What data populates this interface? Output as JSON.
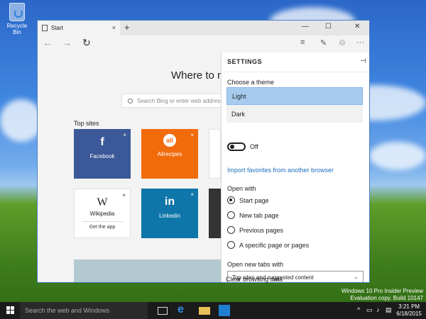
{
  "desktop": {
    "recycle_bin_label": "Recycle Bin"
  },
  "browser": {
    "tab_title": "Start",
    "tab_close": "×",
    "new_tab": "+",
    "minimize": "—",
    "maximize": "☐",
    "close": "✕",
    "back": "←",
    "forward": "→",
    "refresh": "↻",
    "more": "···"
  },
  "start_page": {
    "heading": "Where to ne",
    "search_placeholder": "Search Bing or enter web address",
    "top_sites_label": "Top sites",
    "tiles": [
      {
        "name": "Facebook",
        "logo": "f",
        "color": "#3b5998"
      },
      {
        "name": "Allrecipes",
        "logo": "all",
        "color": "#f16b0b"
      },
      {
        "name": "Wikipedia",
        "logo": "W",
        "sub": "Get the app",
        "color": "#ffffff"
      },
      {
        "name": "Linkedin",
        "logo": "in",
        "color": "#0e76a8"
      }
    ],
    "tile_close": "×"
  },
  "settings": {
    "title": "SETTINGS",
    "pin": "⊣",
    "theme_label": "Choose a theme",
    "theme_options": [
      "Light",
      "Dark"
    ],
    "toggle_state": "Off",
    "import_link": "Import favorites from another browser",
    "open_with_label": "Open with",
    "open_with_options": [
      "Start page",
      "New tab page",
      "Previous pages",
      "A specific page or pages"
    ],
    "open_with_selected": "Start page",
    "new_tabs_label": "Open new tabs with",
    "new_tabs_value": "Top sites and suggested content",
    "clear_label": "Clear browsing data"
  },
  "watermark": {
    "line1": "Windows 10 Pro Insider Preview",
    "line2": "Evaluation copy. Build 10147"
  },
  "taskbar": {
    "search_placeholder": "Search the web and Windows",
    "time": "3:21 PM",
    "date": "6/18/2015"
  }
}
